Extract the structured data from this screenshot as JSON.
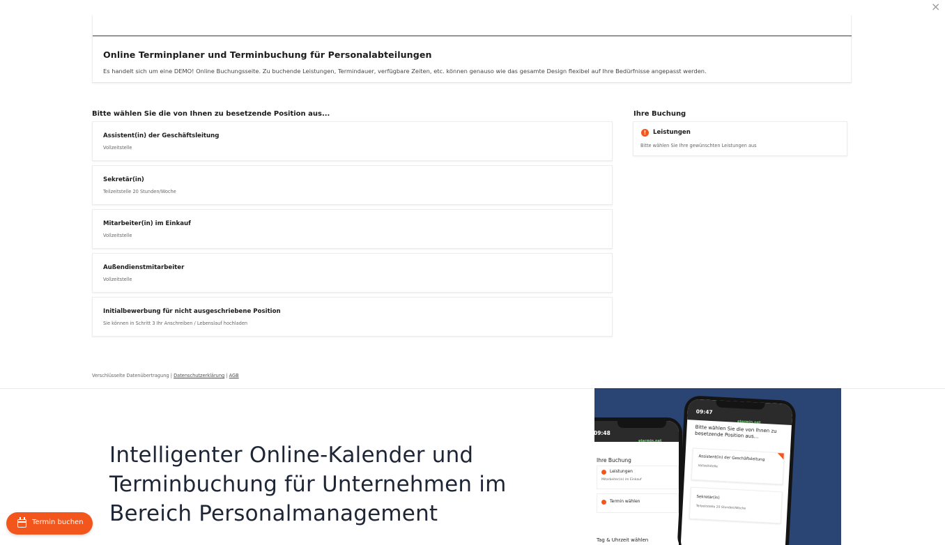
{
  "window": {
    "close_glyph": "×"
  },
  "header": {
    "title": "Online Terminplaner und Terminbuchung für Personalabteilungen",
    "description": "Es handelt sich um eine DEMO! Online Buchungsseite. Zu buchende Leistungen, Termindauer, verfügbare Zeiten, etc. können genauso wie das gesamte Design flexibel auf Ihre Bedürfnisse angepasst werden."
  },
  "positions": {
    "section_title": "Bitte wählen Sie die von Ihnen zu besetzende Position aus...",
    "items": [
      {
        "title": "Assistent(in) der Geschäftsleitung",
        "subtitle": "Vollzeitstelle"
      },
      {
        "title": "Sekretär(in)",
        "subtitle": "Teilzeitstelle 20 Stunden/Woche"
      },
      {
        "title": "Mitarbeiter(in) im Einkauf",
        "subtitle": "Vollzeitstelle"
      },
      {
        "title": "Außendienstmitarbeiter",
        "subtitle": "Vollzeitstelle"
      },
      {
        "title": "Initialbewerbung für nicht ausgeschriebene Position",
        "subtitle": "Sie können in Schritt 3 Ihr Anschreiben / Lebenslauf hochladen"
      }
    ]
  },
  "booking": {
    "title": "Ihre Buchung",
    "step_badge": "!",
    "step_label": "Leistungen",
    "step_hint": "Bitte wählen Sie Ihre gewünschten Leistungen aus"
  },
  "footer": {
    "secure_text": "Verschlüsselte Datenübertragung |",
    "privacy_link": "Datenschutzerklärung",
    "separator": "|",
    "terms_link": "AGB"
  },
  "hero": {
    "heading": "Intelligenter Online-Kalender und Terminbuchung für Unternehmen im Bereich Personalmanagement"
  },
  "phone_left": {
    "time": "09:48",
    "url": "etermin.net",
    "booking_title": "Ihre Buchung",
    "step1_label": "Leistungen",
    "step1_detail": "Mitarbeiter(in) im Einkauf",
    "step2_label": "Termin wählen",
    "section": "Tag & Uhrzeit wählen"
  },
  "phone_right": {
    "time": "09:47",
    "url": "etermin.net",
    "heading": "Bitte wählen Sie die von Ihnen zu besetzende Position aus...",
    "item1_title": "Assistent(in) der Geschäftsleitung",
    "item1_sub": "Vollzeitstelle",
    "item2_title": "Sekretär(in)",
    "item2_sub": "Teilzeitstelle 20 Stunden/Woche"
  },
  "cta": {
    "label": "Termin buchen",
    "icon": "calendar-icon"
  },
  "colors": {
    "accent": "#f2561d",
    "navy": "#2a4474",
    "header_rule": "#2d3e50"
  }
}
